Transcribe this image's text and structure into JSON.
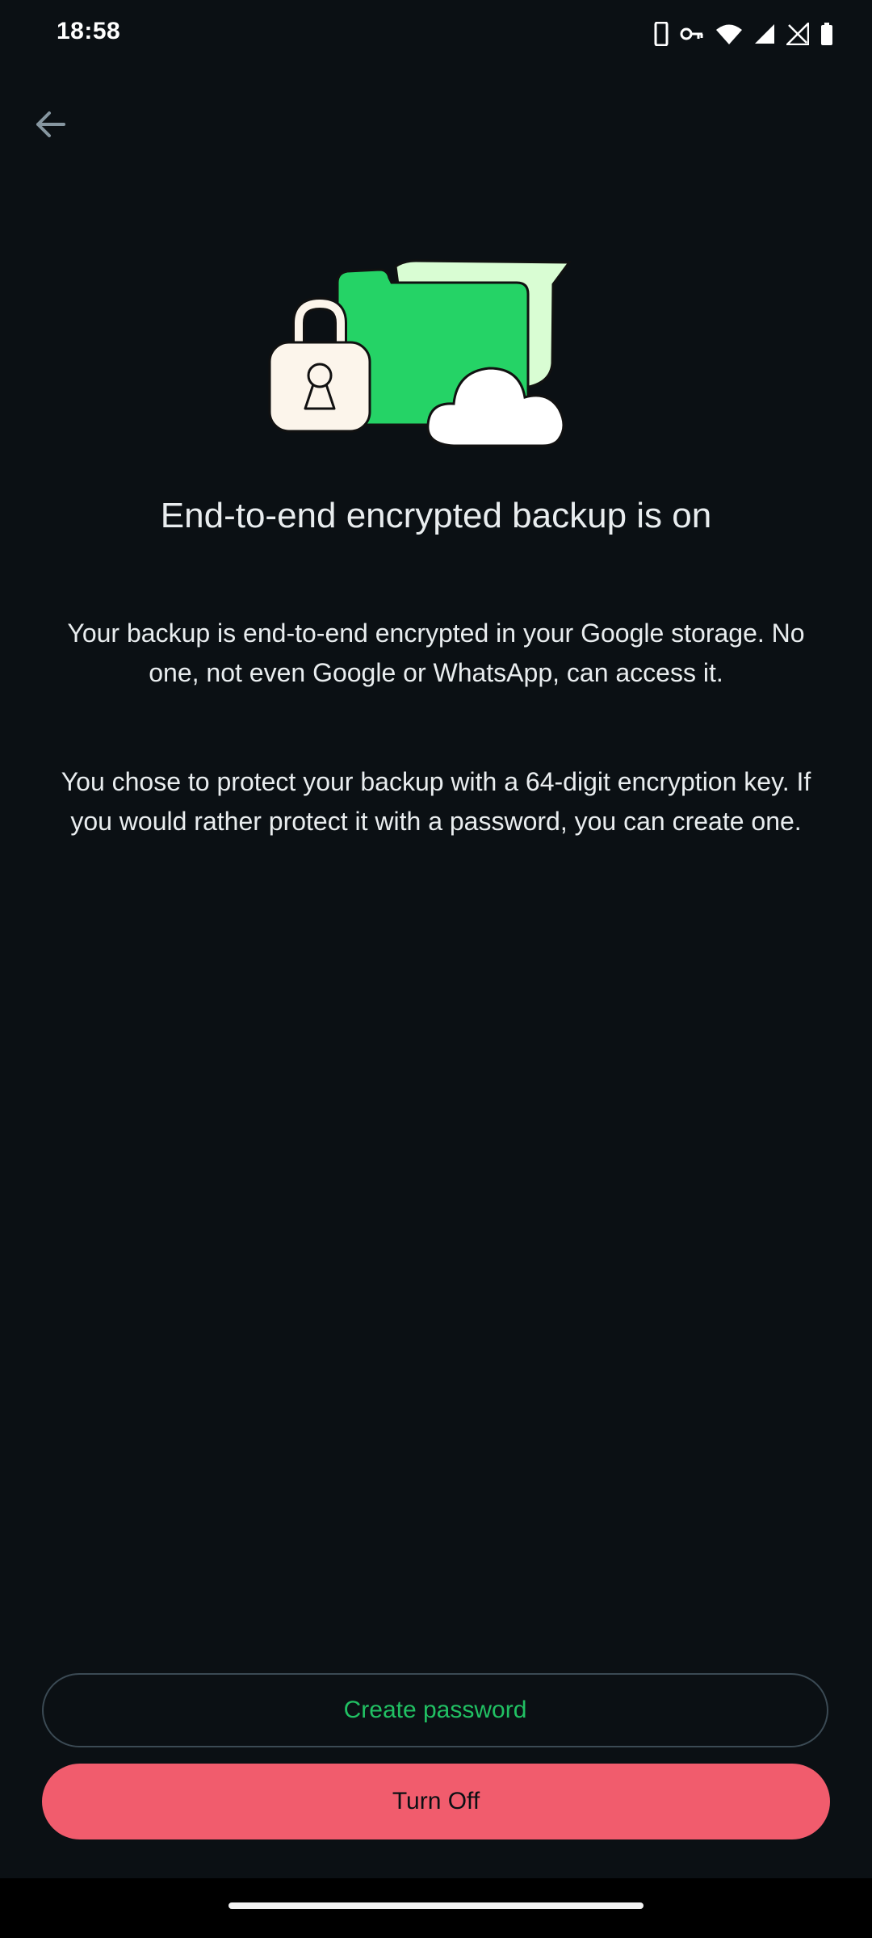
{
  "status_bar": {
    "time": "18:58",
    "icons": [
      "phone-icon",
      "vpn-key-icon",
      "wifi-icon",
      "cell-signal-icon",
      "no-data-icon",
      "battery-icon"
    ]
  },
  "nav": {
    "back_icon": "arrow-back-icon"
  },
  "illustration": {
    "icons": [
      "padlock-icon",
      "folder-icon",
      "chat-bubble-icon",
      "cloud-icon"
    ],
    "colors": {
      "folder": "#25d366",
      "bubble": "#d9fdd3",
      "lock": "#fcf5eb",
      "cloud": "#ffffff"
    }
  },
  "content": {
    "title": "End-to-end encrypted backup is on",
    "paragraph1": "Your backup is end-to-end encrypted in your Google storage. No one, not even Google or WhatsApp, can access it.",
    "paragraph2": "You chose to protect your backup with a 64-digit encryption key. If you would rather protect it with a password, you can create one."
  },
  "actions": {
    "create_password": "Create password",
    "turn_off": "Turn Off"
  },
  "colors": {
    "background": "#0b1014",
    "accent": "#21c063",
    "danger": "#f15c6d"
  }
}
